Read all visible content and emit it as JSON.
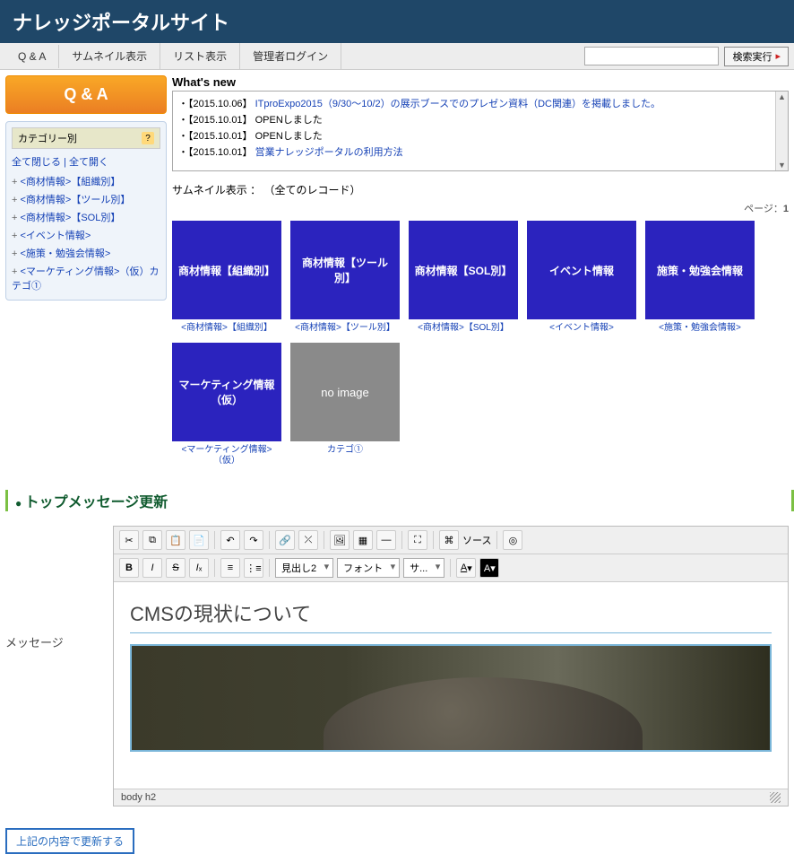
{
  "header": {
    "title": "ナレッジポータルサイト"
  },
  "toolbar": {
    "items": [
      "Q & A",
      "サムネイル表示",
      "リスト表示",
      "管理者ログイン"
    ],
    "search_placeholder": "",
    "search_button": "検索実行"
  },
  "sidebar": {
    "qa_label": "Q & A",
    "category_title": "カテゴリー別",
    "toggle_close": "全て閉じる",
    "toggle_open": "全て開く",
    "items": [
      "<商材情報>【組織別】",
      "<商材情報>【ツール別】",
      "<商材情報>【SOL別】",
      "<イベント情報>",
      "<施策・勉強会情報>",
      "<マーケティング情報>（仮）カテゴ①"
    ]
  },
  "whatsnew": {
    "title": "What's new",
    "items": [
      {
        "date": "【2015.10.06】",
        "text": "ITproExpo2015（9/30～10/2）の展示ブースでのプレゼン資料（DC関連）を掲載しました。",
        "link": true
      },
      {
        "date": "【2015.10.01】",
        "text": "OPENしました",
        "link": false
      },
      {
        "date": "【2015.10.01】",
        "text": "OPENしました",
        "link": false
      },
      {
        "date": "【2015.10.01】",
        "text": "営業ナレッジポータルの利用方法",
        "link": true
      }
    ]
  },
  "thumb": {
    "label": "サムネイル表示 ：",
    "scope": "（全てのレコード）",
    "page_label": "ページ：",
    "page_num": "1",
    "tiles": [
      {
        "title": "商材情報【組織別】",
        "caption": "<商材情報>【組織別】"
      },
      {
        "title": "商材情報【ツール別】",
        "caption": "<商材情報>【ツール別】"
      },
      {
        "title": "商材情報【SOL別】",
        "caption": "<商材情報>【SOL別】"
      },
      {
        "title": "イベント情報",
        "caption": "<イベント情報>"
      },
      {
        "title": "施策・勉強会情報",
        "caption": "<施策・勉強会情報>"
      },
      {
        "title": "マーケティング情報（仮）",
        "caption": "<マーケティング情報>（仮）"
      },
      {
        "title": "no image",
        "caption": "カテゴ①",
        "noimg": true
      }
    ]
  },
  "section": {
    "title": "トップメッセージ更新"
  },
  "editor": {
    "side_label": "メッセージ",
    "heading_sel": "見出し2",
    "font_sel": "フォント",
    "size_sel": "サ...",
    "source_label": "ソース",
    "content_heading": "CMSの現状について",
    "path": "body  h2"
  },
  "update_button": "上記の内容で更新する"
}
